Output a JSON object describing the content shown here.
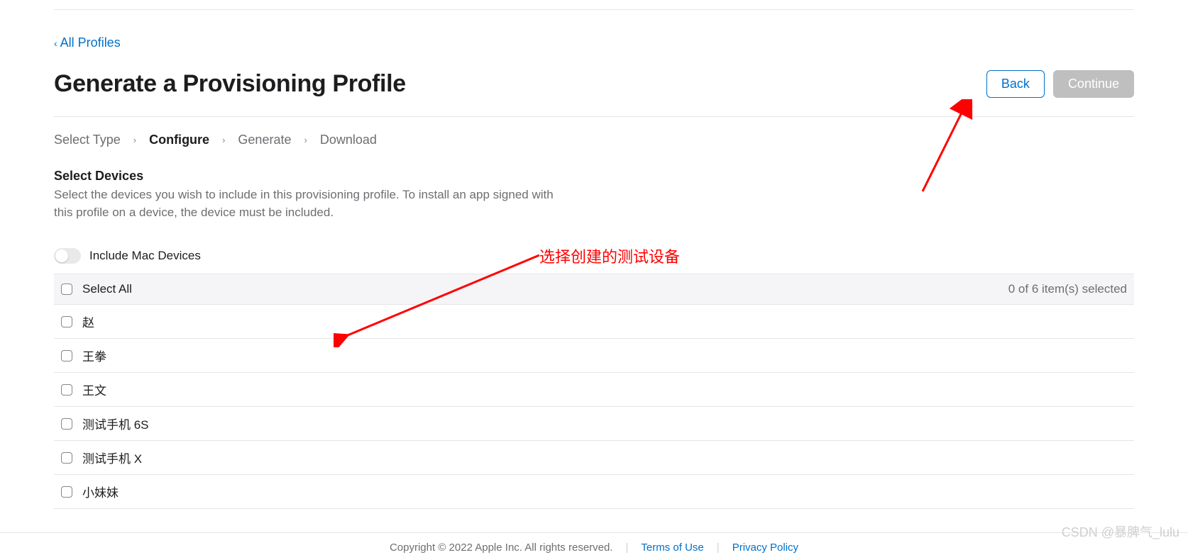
{
  "nav": {
    "all_profiles": "All Profiles"
  },
  "header": {
    "title": "Generate a Provisioning Profile",
    "back_label": "Back",
    "continue_label": "Continue"
  },
  "breadcrumb": {
    "steps": [
      "Select Type",
      "Configure",
      "Generate",
      "Download"
    ],
    "active_index": 1
  },
  "section": {
    "heading": "Select Devices",
    "desc": "Select the devices you wish to include in this provisioning profile. To install an app signed with this profile on a device, the device must be included."
  },
  "toggle": {
    "label": "Include Mac Devices",
    "on": false
  },
  "device_table": {
    "select_all_label": "Select All",
    "selected_count_text": "0 of 6 item(s) selected",
    "items": [
      {
        "label": "赵",
        "checked": false
      },
      {
        "label": "王拳",
        "checked": false
      },
      {
        "label": "王文",
        "checked": false
      },
      {
        "label": "测试手机 6S",
        "checked": false
      },
      {
        "label": "测试手机 X",
        "checked": false
      },
      {
        "label": "小妹妹",
        "checked": false
      }
    ]
  },
  "annotation": {
    "text": "选择创建的测试设备"
  },
  "footer": {
    "copyright": "Copyright © 2022 Apple Inc. All rights reserved.",
    "terms": "Terms of Use",
    "privacy": "Privacy Policy"
  },
  "watermark": "CSDN @暴脾气_lulu"
}
